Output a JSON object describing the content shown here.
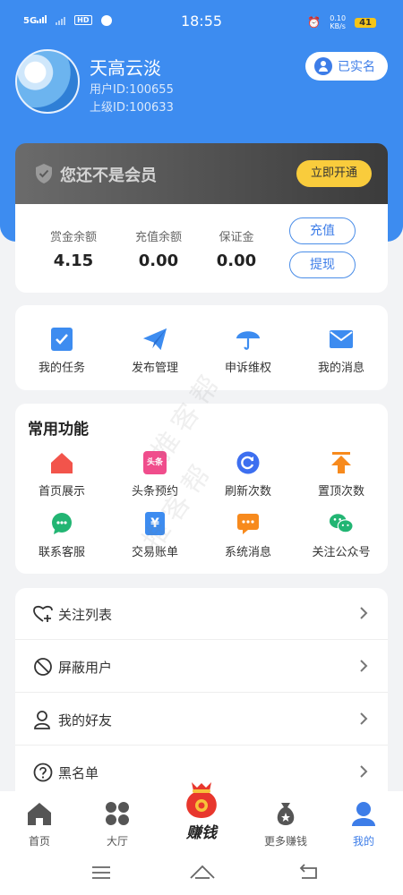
{
  "status_bar": {
    "network": "5G",
    "hd": "HD",
    "time": "18:55",
    "speed_value": "0.10",
    "speed_unit": "KB/s",
    "battery": "41"
  },
  "profile": {
    "nickname": "天高云淡",
    "user_id": "用户ID:100655",
    "parent_id": "上级ID:100633",
    "verified_label": "已实名"
  },
  "membership": {
    "title": "您还不是会员",
    "open_label": "立即开通"
  },
  "balance": {
    "items": [
      {
        "label": "赏金余额",
        "value": "4.15"
      },
      {
        "label": "充值余额",
        "value": "0.00"
      },
      {
        "label": "保证金",
        "value": "0.00"
      }
    ],
    "recharge_label": "充值",
    "withdraw_label": "提现"
  },
  "quick": [
    {
      "label": "我的任务",
      "icon": "task-icon"
    },
    {
      "label": "发布管理",
      "icon": "paper-plane-icon"
    },
    {
      "label": "申诉维权",
      "icon": "umbrella-icon"
    },
    {
      "label": "我的消息",
      "icon": "mail-icon"
    }
  ],
  "common": {
    "title": "常用功能",
    "items": [
      {
        "label": "首页展示",
        "icon": "home-red-icon"
      },
      {
        "label": "头条预约",
        "icon": "headline-icon",
        "badge": "头条"
      },
      {
        "label": "刷新次数",
        "icon": "refresh-icon"
      },
      {
        "label": "置顶次数",
        "icon": "pin-top-icon"
      },
      {
        "label": "联系客服",
        "icon": "chat-icon"
      },
      {
        "label": "交易账单",
        "icon": "bill-icon"
      },
      {
        "label": "系统消息",
        "icon": "system-message-icon"
      },
      {
        "label": "关注公众号",
        "icon": "wechat-icon"
      }
    ]
  },
  "list": [
    {
      "label": "关注列表",
      "icon": "heart-plus-icon"
    },
    {
      "label": "屏蔽用户",
      "icon": "block-icon"
    },
    {
      "label": "我的好友",
      "icon": "friends-icon"
    },
    {
      "label": "黑名单",
      "icon": "question-icon"
    }
  ],
  "tabs": [
    {
      "label": "首页",
      "icon": "home-icon"
    },
    {
      "label": "大厅",
      "icon": "hall-icon"
    },
    {
      "label": "赚钱",
      "icon": "money-bag-icon"
    },
    {
      "label": "更多赚钱",
      "icon": "more-money-icon"
    },
    {
      "label": "我的",
      "icon": "profile-icon"
    }
  ],
  "watermark": "推客帮",
  "colors": {
    "primary": "#3d8cf0",
    "accent_yellow": "#f9cc3c",
    "background": "#f2f3f5"
  }
}
